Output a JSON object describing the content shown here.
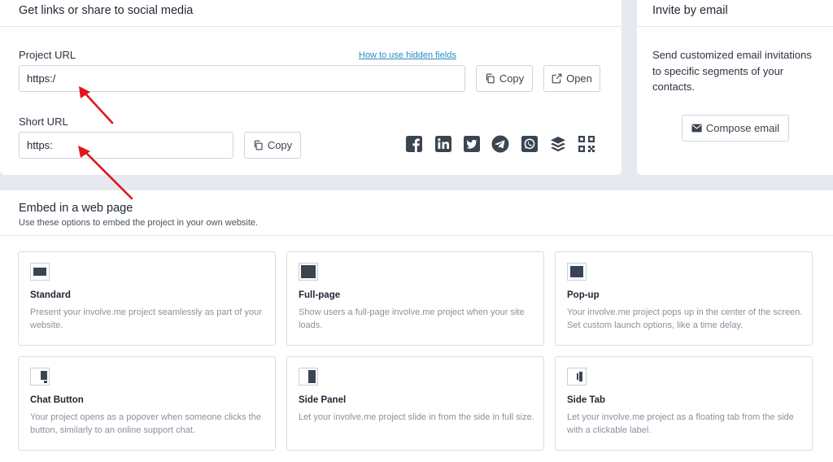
{
  "share": {
    "title": "Get links or share to social media",
    "project_url_label": "Project URL",
    "project_url_value": "https:/",
    "hidden_fields_link": "How to use hidden fields",
    "copy_label": "Copy",
    "open_label": "Open",
    "short_url_label": "Short URL",
    "short_url_value": "https:",
    "social_icons": [
      "facebook-icon",
      "linkedin-icon",
      "twitter-icon",
      "telegram-icon",
      "whatsapp-icon",
      "buffer-icon",
      "qr-code-icon"
    ]
  },
  "invite": {
    "title": "Invite by email",
    "description": "Send customized email invitations to specific segments of your contacts.",
    "compose_label": "Compose email"
  },
  "embed": {
    "title": "Embed in a web page",
    "subtitle": "Use these options to embed the project in your own website.",
    "options": [
      {
        "title": "Standard",
        "description": "Present your involve.me project seamlessly as part of your website."
      },
      {
        "title": "Full-page",
        "description": "Show users a full-page involve.me project when your site loads."
      },
      {
        "title": "Pop-up",
        "description": "Your involve.me project pops up in the center of the screen. Set custom launch options, like a time delay."
      },
      {
        "title": "Chat Button",
        "description": "Your project opens as a popover when someone clicks the button, similarly to an online support chat."
      },
      {
        "title": "Side Panel",
        "description": "Let your involve.me project slide in from the side in full size."
      },
      {
        "title": "Side Tab",
        "description": "Let your involve.me project as a floating tab from the side with a clickable label."
      }
    ]
  },
  "colors": {
    "background": "#e6e9ef",
    "icon_dark": "#3a4552",
    "link": "#2a8bc1",
    "annotation_arrow": "#e0161c"
  }
}
